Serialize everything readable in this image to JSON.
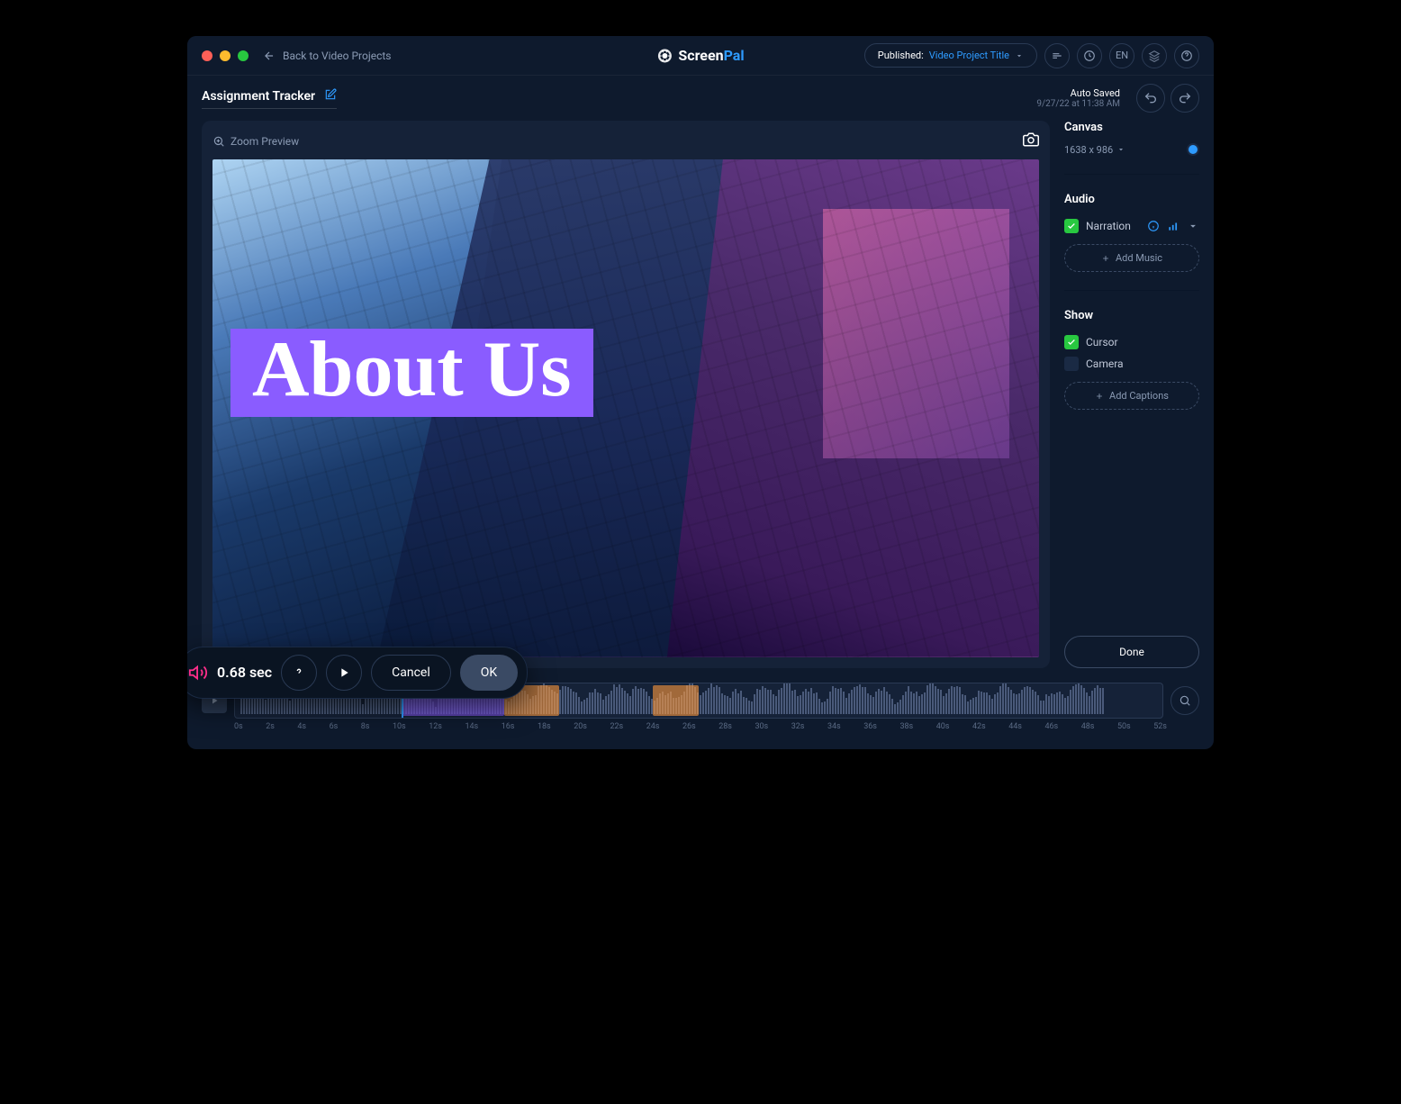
{
  "titlebar": {
    "back_label": "Back to Video Projects",
    "brand_screen": "Screen",
    "brand_pal": "Pal",
    "publish_label": "Published:",
    "publish_title": "Video Project Title",
    "lang_label": "EN"
  },
  "subheader": {
    "project_title": "Assignment Tracker",
    "autosave_line1": "Auto Saved",
    "autosave_line2": "9/27/22 at 11:38 AM"
  },
  "preview": {
    "zoom_label": "Zoom Preview",
    "overlay_text": "About Us"
  },
  "sidebar": {
    "canvas_title": "Canvas",
    "canvas_size": "1638 x 986",
    "canvas_color": "#2e9bff",
    "audio_title": "Audio",
    "narration_label": "Narration",
    "add_music_label": "Add Music",
    "show_title": "Show",
    "cursor_label": "Cursor",
    "camera_label": "Camera",
    "add_captions_label": "Add Captions",
    "done_label": "Done"
  },
  "toolbar": {
    "time_value": "0.68 sec",
    "cancel_label": "Cancel",
    "ok_label": "OK"
  },
  "timeline": {
    "ticks": [
      "0s",
      "2s",
      "4s",
      "6s",
      "8s",
      "10s",
      "12s",
      "14s",
      "16s",
      "18s",
      "20s",
      "22s",
      "24s",
      "26s",
      "28s",
      "30s",
      "32s",
      "34s",
      "36s",
      "38s",
      "40s",
      "42s",
      "44s",
      "46s",
      "48s",
      "50s",
      "52s"
    ],
    "playhead_percent": 18,
    "clips": [
      {
        "start_pct": 18,
        "end_pct": 29,
        "color": "purple"
      },
      {
        "start_pct": 29,
        "end_pct": 35,
        "color": "orange"
      },
      {
        "start_pct": 45,
        "end_pct": 50,
        "color": "orange"
      }
    ]
  }
}
